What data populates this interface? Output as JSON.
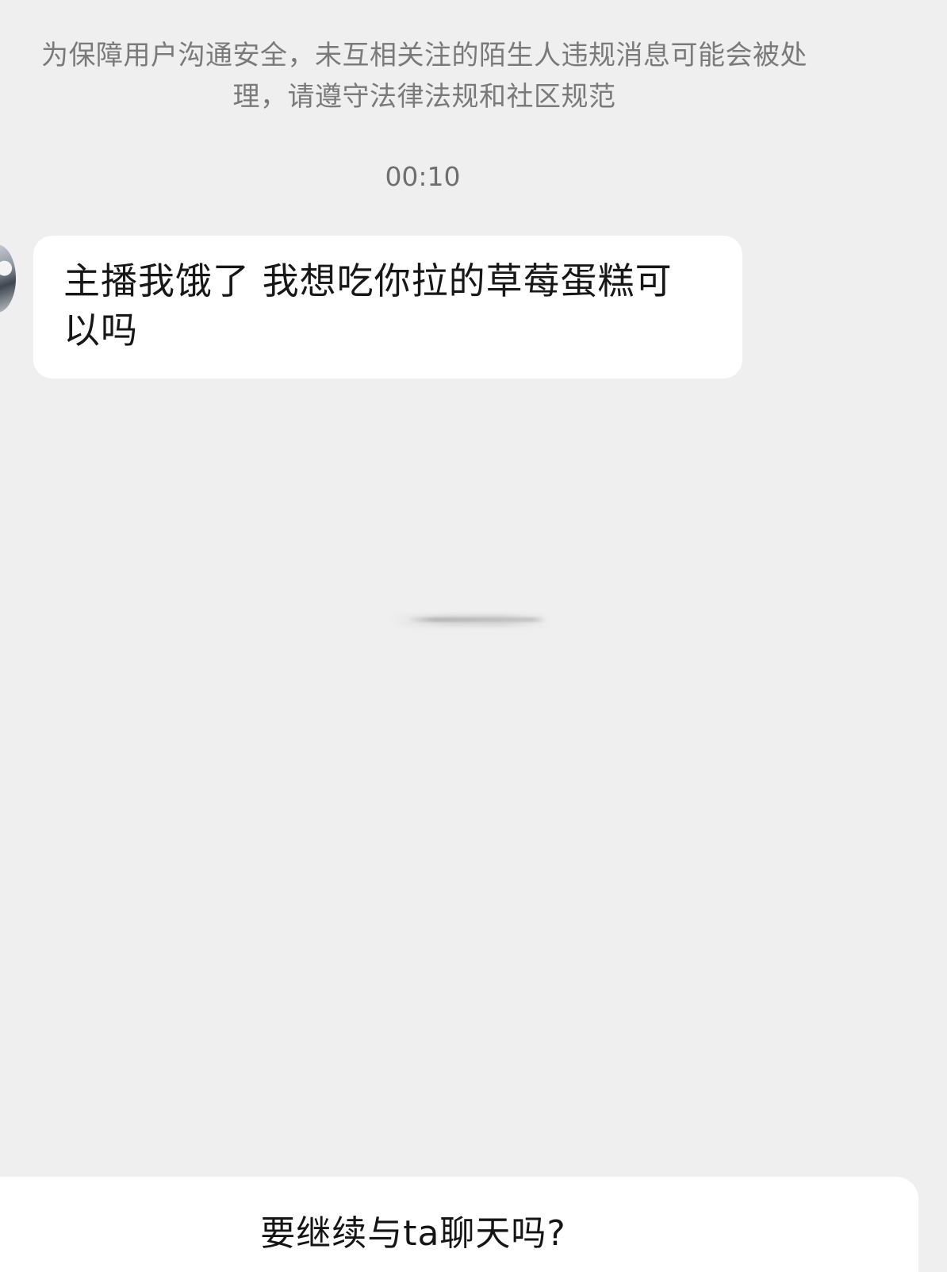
{
  "notice": {
    "line1": "为保障用户沟通安全，未互相关注的陌生人违规消息可能会被处",
    "line2": "理，请遵守法律法规和社区规范"
  },
  "chat": {
    "timestamp": "00:10",
    "messages": [
      {
        "sender": "other",
        "text_line1": "主播我饿了 我想吃你拉的草莓蛋糕可",
        "text_line2": "以吗"
      }
    ]
  },
  "prompt_panel": {
    "question": "要继续与ta聊天吗?"
  },
  "icons": {
    "avatar": "avatar"
  }
}
